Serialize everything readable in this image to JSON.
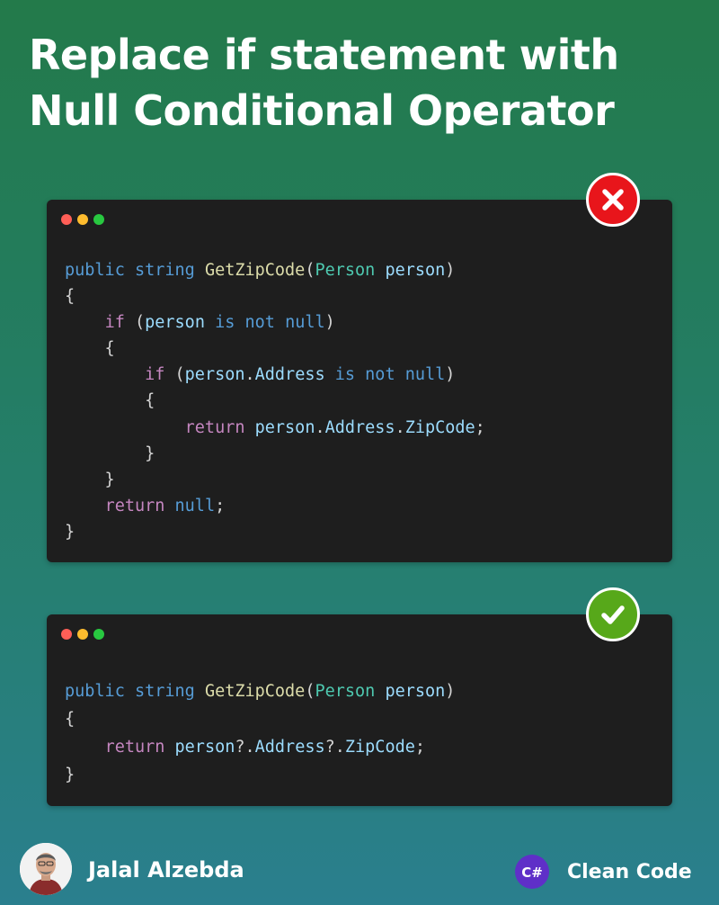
{
  "title": "Replace if statement with Null Conditional Operator",
  "colors": {
    "keyword": "#569cd6",
    "control": "#c586c0",
    "type": "#4ec9b0",
    "function": "#dcdcaa",
    "identifier": "#9cdcfe",
    "bad_badge": "#e8151b",
    "good_badge": "#57a81a"
  },
  "bad_example": {
    "status_icon": "x-mark-icon",
    "lines": [
      [
        {
          "t": "public",
          "c": "kw"
        },
        {
          "t": " ",
          "c": "pl"
        },
        {
          "t": "string",
          "c": "kw"
        },
        {
          "t": " ",
          "c": "pl"
        },
        {
          "t": "GetZipCode",
          "c": "fn"
        },
        {
          "t": "(",
          "c": "pl"
        },
        {
          "t": "Person",
          "c": "ty"
        },
        {
          "t": " ",
          "c": "pl"
        },
        {
          "t": "person",
          "c": "id"
        },
        {
          "t": ")",
          "c": "pl"
        }
      ],
      [
        {
          "t": "{",
          "c": "pl"
        }
      ],
      [
        {
          "t": "    ",
          "c": "pl"
        },
        {
          "t": "if",
          "c": "ctl"
        },
        {
          "t": " (",
          "c": "pl"
        },
        {
          "t": "person",
          "c": "id"
        },
        {
          "t": " ",
          "c": "pl"
        },
        {
          "t": "is",
          "c": "kw"
        },
        {
          "t": " ",
          "c": "pl"
        },
        {
          "t": "not",
          "c": "kw"
        },
        {
          "t": " ",
          "c": "pl"
        },
        {
          "t": "null",
          "c": "kw"
        },
        {
          "t": ")",
          "c": "pl"
        }
      ],
      [
        {
          "t": "    {",
          "c": "pl"
        }
      ],
      [
        {
          "t": "        ",
          "c": "pl"
        },
        {
          "t": "if",
          "c": "ctl"
        },
        {
          "t": " (",
          "c": "pl"
        },
        {
          "t": "person",
          "c": "id"
        },
        {
          "t": ".",
          "c": "pl"
        },
        {
          "t": "Address",
          "c": "id"
        },
        {
          "t": " ",
          "c": "pl"
        },
        {
          "t": "is",
          "c": "kw"
        },
        {
          "t": " ",
          "c": "pl"
        },
        {
          "t": "not",
          "c": "kw"
        },
        {
          "t": " ",
          "c": "pl"
        },
        {
          "t": "null",
          "c": "kw"
        },
        {
          "t": ")",
          "c": "pl"
        }
      ],
      [
        {
          "t": "        {",
          "c": "pl"
        }
      ],
      [
        {
          "t": "            ",
          "c": "pl"
        },
        {
          "t": "return",
          "c": "ctl"
        },
        {
          "t": " ",
          "c": "pl"
        },
        {
          "t": "person",
          "c": "id"
        },
        {
          "t": ".",
          "c": "pl"
        },
        {
          "t": "Address",
          "c": "id"
        },
        {
          "t": ".",
          "c": "pl"
        },
        {
          "t": "ZipCode",
          "c": "id"
        },
        {
          "t": ";",
          "c": "pl"
        }
      ],
      [
        {
          "t": "        }",
          "c": "pl"
        }
      ],
      [
        {
          "t": "    }",
          "c": "pl"
        }
      ],
      [
        {
          "t": "    ",
          "c": "pl"
        },
        {
          "t": "return",
          "c": "ctl"
        },
        {
          "t": " ",
          "c": "pl"
        },
        {
          "t": "null",
          "c": "kw"
        },
        {
          "t": ";",
          "c": "pl"
        }
      ],
      [
        {
          "t": "}",
          "c": "pl"
        }
      ]
    ]
  },
  "good_example": {
    "status_icon": "check-mark-icon",
    "lines": [
      [
        {
          "t": "public",
          "c": "kw"
        },
        {
          "t": " ",
          "c": "pl"
        },
        {
          "t": "string",
          "c": "kw"
        },
        {
          "t": " ",
          "c": "pl"
        },
        {
          "t": "GetZipCode",
          "c": "fn"
        },
        {
          "t": "(",
          "c": "pl"
        },
        {
          "t": "Person",
          "c": "ty"
        },
        {
          "t": " ",
          "c": "pl"
        },
        {
          "t": "person",
          "c": "id"
        },
        {
          "t": ")",
          "c": "pl"
        }
      ],
      [
        {
          "t": "{",
          "c": "pl"
        }
      ],
      [
        {
          "t": "    ",
          "c": "pl"
        },
        {
          "t": "return",
          "c": "ctl"
        },
        {
          "t": " ",
          "c": "pl"
        },
        {
          "t": "person",
          "c": "id"
        },
        {
          "t": "?.",
          "c": "pl"
        },
        {
          "t": "Address",
          "c": "id"
        },
        {
          "t": "?.",
          "c": "pl"
        },
        {
          "t": "ZipCode",
          "c": "id"
        },
        {
          "t": ";",
          "c": "pl"
        }
      ],
      [
        {
          "t": "}",
          "c": "pl"
        }
      ]
    ]
  },
  "footer": {
    "author_name": "Jalal Alzebda",
    "brand_label": "Clean Code",
    "brand_logo_text": "C#"
  }
}
